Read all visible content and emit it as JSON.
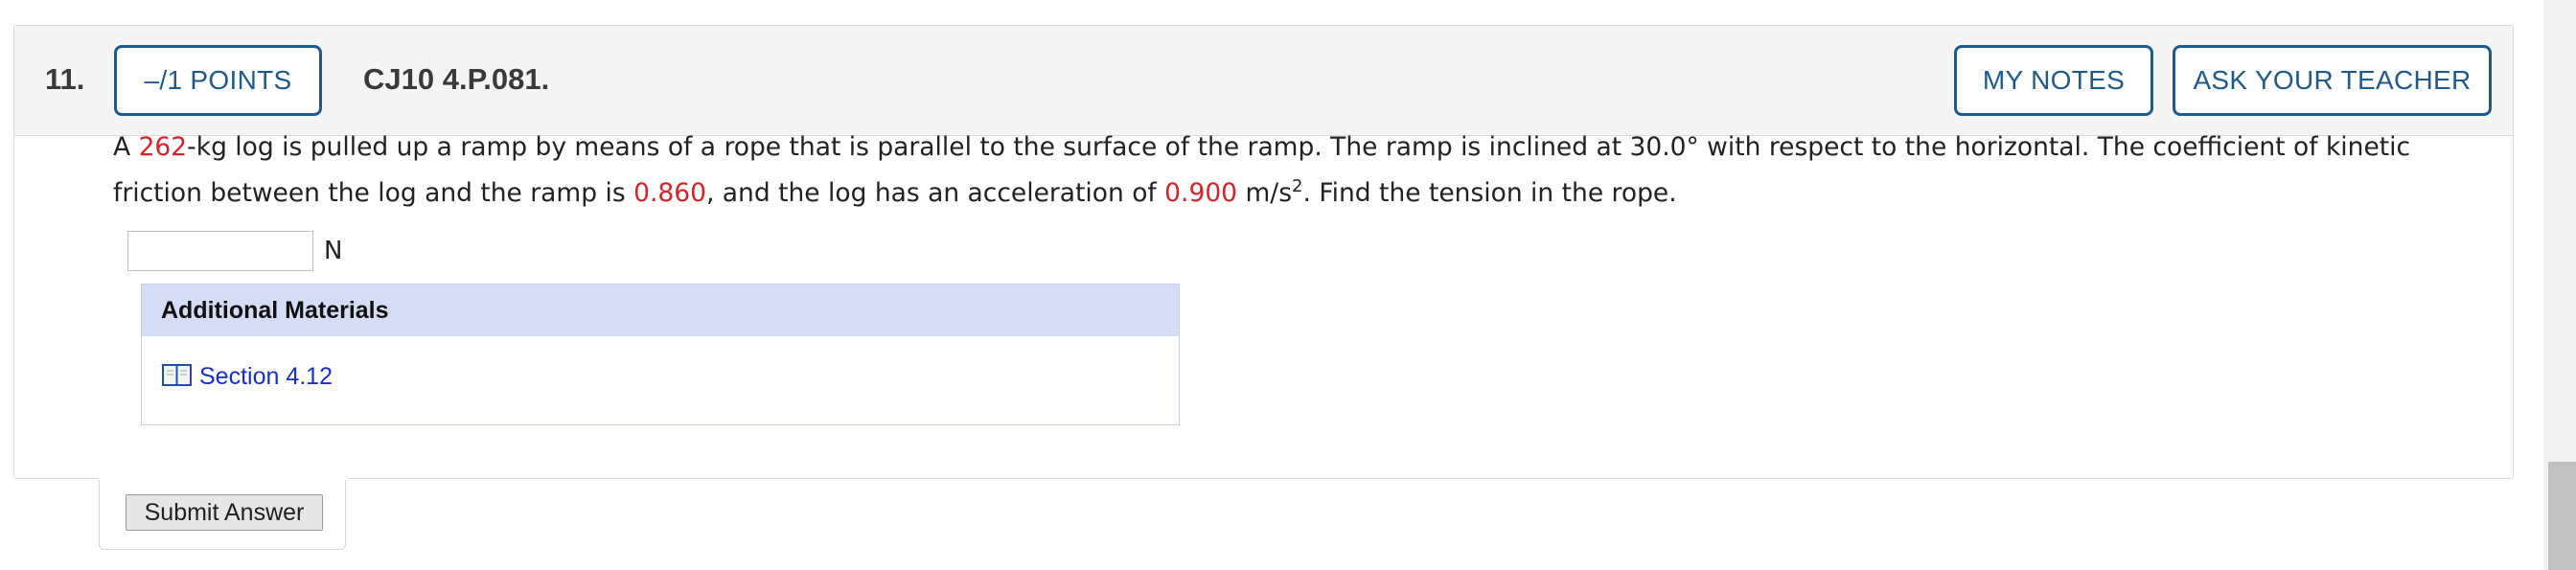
{
  "header": {
    "number": "11.",
    "points_label": "–/1 POINTS",
    "title": "CJ10 4.P.081.",
    "my_notes_label": "MY NOTES",
    "ask_teacher_label": "ASK YOUR TEACHER"
  },
  "question": {
    "segment_1": "A ",
    "mass": "262",
    "segment_2": "-kg log is pulled up a ramp by means of a rope that is parallel to the surface of the ramp. The ramp is inclined at 30.0° with respect to the horizontal. The coefficient of kinetic friction between the log and the ramp is ",
    "mu": "0.860",
    "segment_3": ", and the log has an acceleration of ",
    "accel": "0.900",
    "segment_4": " m/s",
    "exponent": "2",
    "segment_5": ". Find the tension in the rope."
  },
  "answer": {
    "value": "",
    "unit": "N"
  },
  "materials": {
    "heading": "Additional Materials",
    "link_label": "Section 4.12",
    "icon": "book-icon"
  },
  "actions": {
    "submit_label": "Submit Answer"
  },
  "colors": {
    "accent": "#1f5a8a",
    "highlight": "#d4232a",
    "materials_header": "#d5dcf5",
    "link": "#1a2fc6"
  }
}
